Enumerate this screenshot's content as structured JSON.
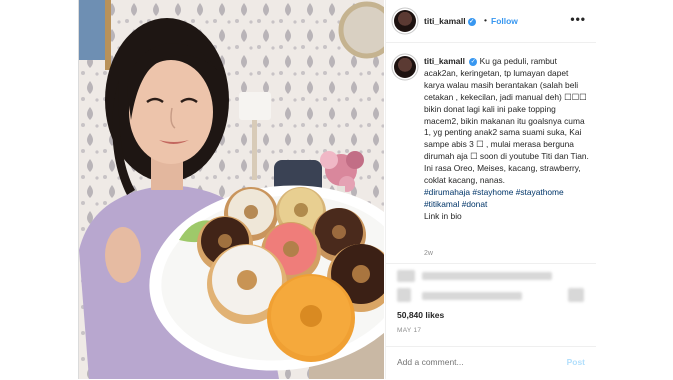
{
  "header": {
    "username": "titi_kamall",
    "separator": "•",
    "follow_label": "Follow",
    "more_icon": "•••"
  },
  "caption": {
    "username": "titi_kamall",
    "text": "Ku ga peduli, rambut acak2an, keringetan, tp lumayan dapet karya walau masih berantakan (salah beli cetakan , kekecilan, jadi manual deh) ☐☐☐ bikin donat lagi kali ini pake topping macem2, bikin makanan itu goalsnya cuma 1, yg penting anak2 sama suami suka, Kai sampe abis 3 ☐ , mulai merasa berguna dirumah aja ☐ soon di youtube Titi dan Tian.",
    "flavors": "Ini rasa Oreo, Meises, kacang, strawberry, coklat kacang, nanas.",
    "hashtags": "#dirumahaja #stayhome #stayathome #titikamal #donat",
    "link": "Link in bio",
    "time_ago": "2w"
  },
  "likes": "50,840 likes",
  "date": "MAY 17",
  "comment": {
    "placeholder": "Add a comment...",
    "post_label": "Post"
  },
  "colors": {
    "accent": "#3897f0",
    "hashtag": "#003569",
    "post_disabled": "#b2dffc"
  }
}
